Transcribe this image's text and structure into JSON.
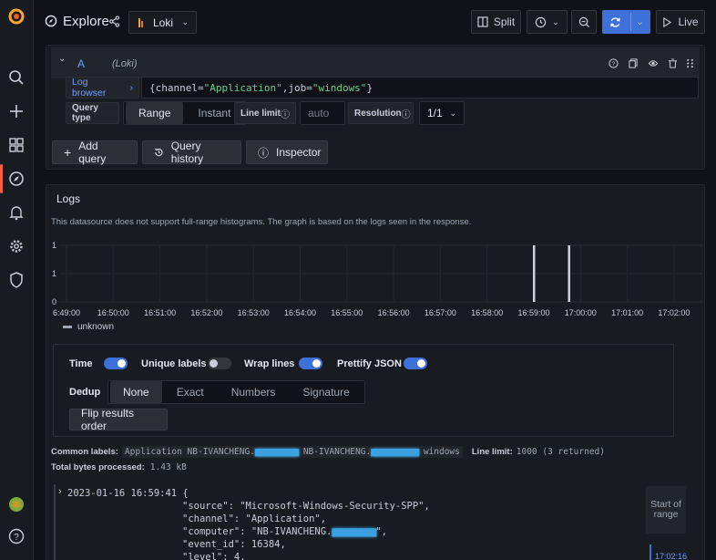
{
  "topbar": {
    "title": "Explore",
    "datasource": "Loki",
    "split": "Split",
    "live": "Live"
  },
  "query": {
    "ref_id": "A",
    "ds_tag": "(Loki)",
    "log_browser": "Log browser",
    "expr_open": "{channel=",
    "expr_v1": "\"Application\"",
    "expr_mid": ",job=",
    "expr_v2": "\"windows\"",
    "expr_close": "}",
    "query_type_label": "Query type",
    "type_range": "Range",
    "type_instant": "Instant",
    "line_limit_label": "Line limit",
    "line_limit_placeholder": "auto",
    "resolution_label": "Resolution",
    "resolution_value": "1/1"
  },
  "actions": {
    "add_query": "Add query",
    "query_history": "Query history",
    "inspector": "Inspector"
  },
  "logs": {
    "title": "Logs",
    "notice": "This datasource does not support full-range histograms. The graph is based on the logs seen in the response.",
    "y_ticks": [
      "1",
      "1",
      "0"
    ],
    "x_ticks": [
      "6:49:00",
      "16:50:00",
      "16:51:00",
      "16:52:00",
      "16:53:00",
      "16:54:00",
      "16:55:00",
      "16:56:00",
      "16:57:00",
      "16:58:00",
      "16:59:00",
      "17:00:00",
      "17:01:00",
      "17:02:00"
    ],
    "legend": "unknown",
    "bars_at": [
      10.0,
      10.75
    ],
    "options": {
      "time": "Time",
      "unique_labels": "Unique labels",
      "wrap_lines": "Wrap lines",
      "prettify_json": "Prettify JSON",
      "time_on": true,
      "unique_on": false,
      "wrap_on": true,
      "prettify_on": true
    },
    "dedup_label": "Dedup",
    "dedup_opts": [
      "None",
      "Exact",
      "Numbers",
      "Signature"
    ],
    "flip": "Flip results order",
    "common_labels_label": "Common labels:",
    "common_labels_a": "Application NB-IVANCHENG.",
    "common_labels_b": " NB-IVANCHENG.",
    "common_labels_c": " windows",
    "line_limit_label": "Line limit:",
    "line_limit_value": "1000 (3 returned)",
    "total_bytes_label": "Total bytes processed:",
    "total_bytes_value": "1.43 kB",
    "entry_ts": "2023-01-16 16:59:41 {",
    "entry_lines": [
      "\"source\": \"Microsoft-Windows-Security-SPP\",",
      "\"channel\": \"Application\",",
      "\"computer\": \"NB-IVANCHENG.",
      "\"event_id\": 16384,",
      "\"level\": 4,"
    ],
    "computer_tail": "\",",
    "start_of_range": "Start of range",
    "range_time": "17:02:16"
  },
  "colors": {
    "accent": "#3d71d9",
    "brand": "#f55f3e",
    "string": "#6ccf8e"
  }
}
